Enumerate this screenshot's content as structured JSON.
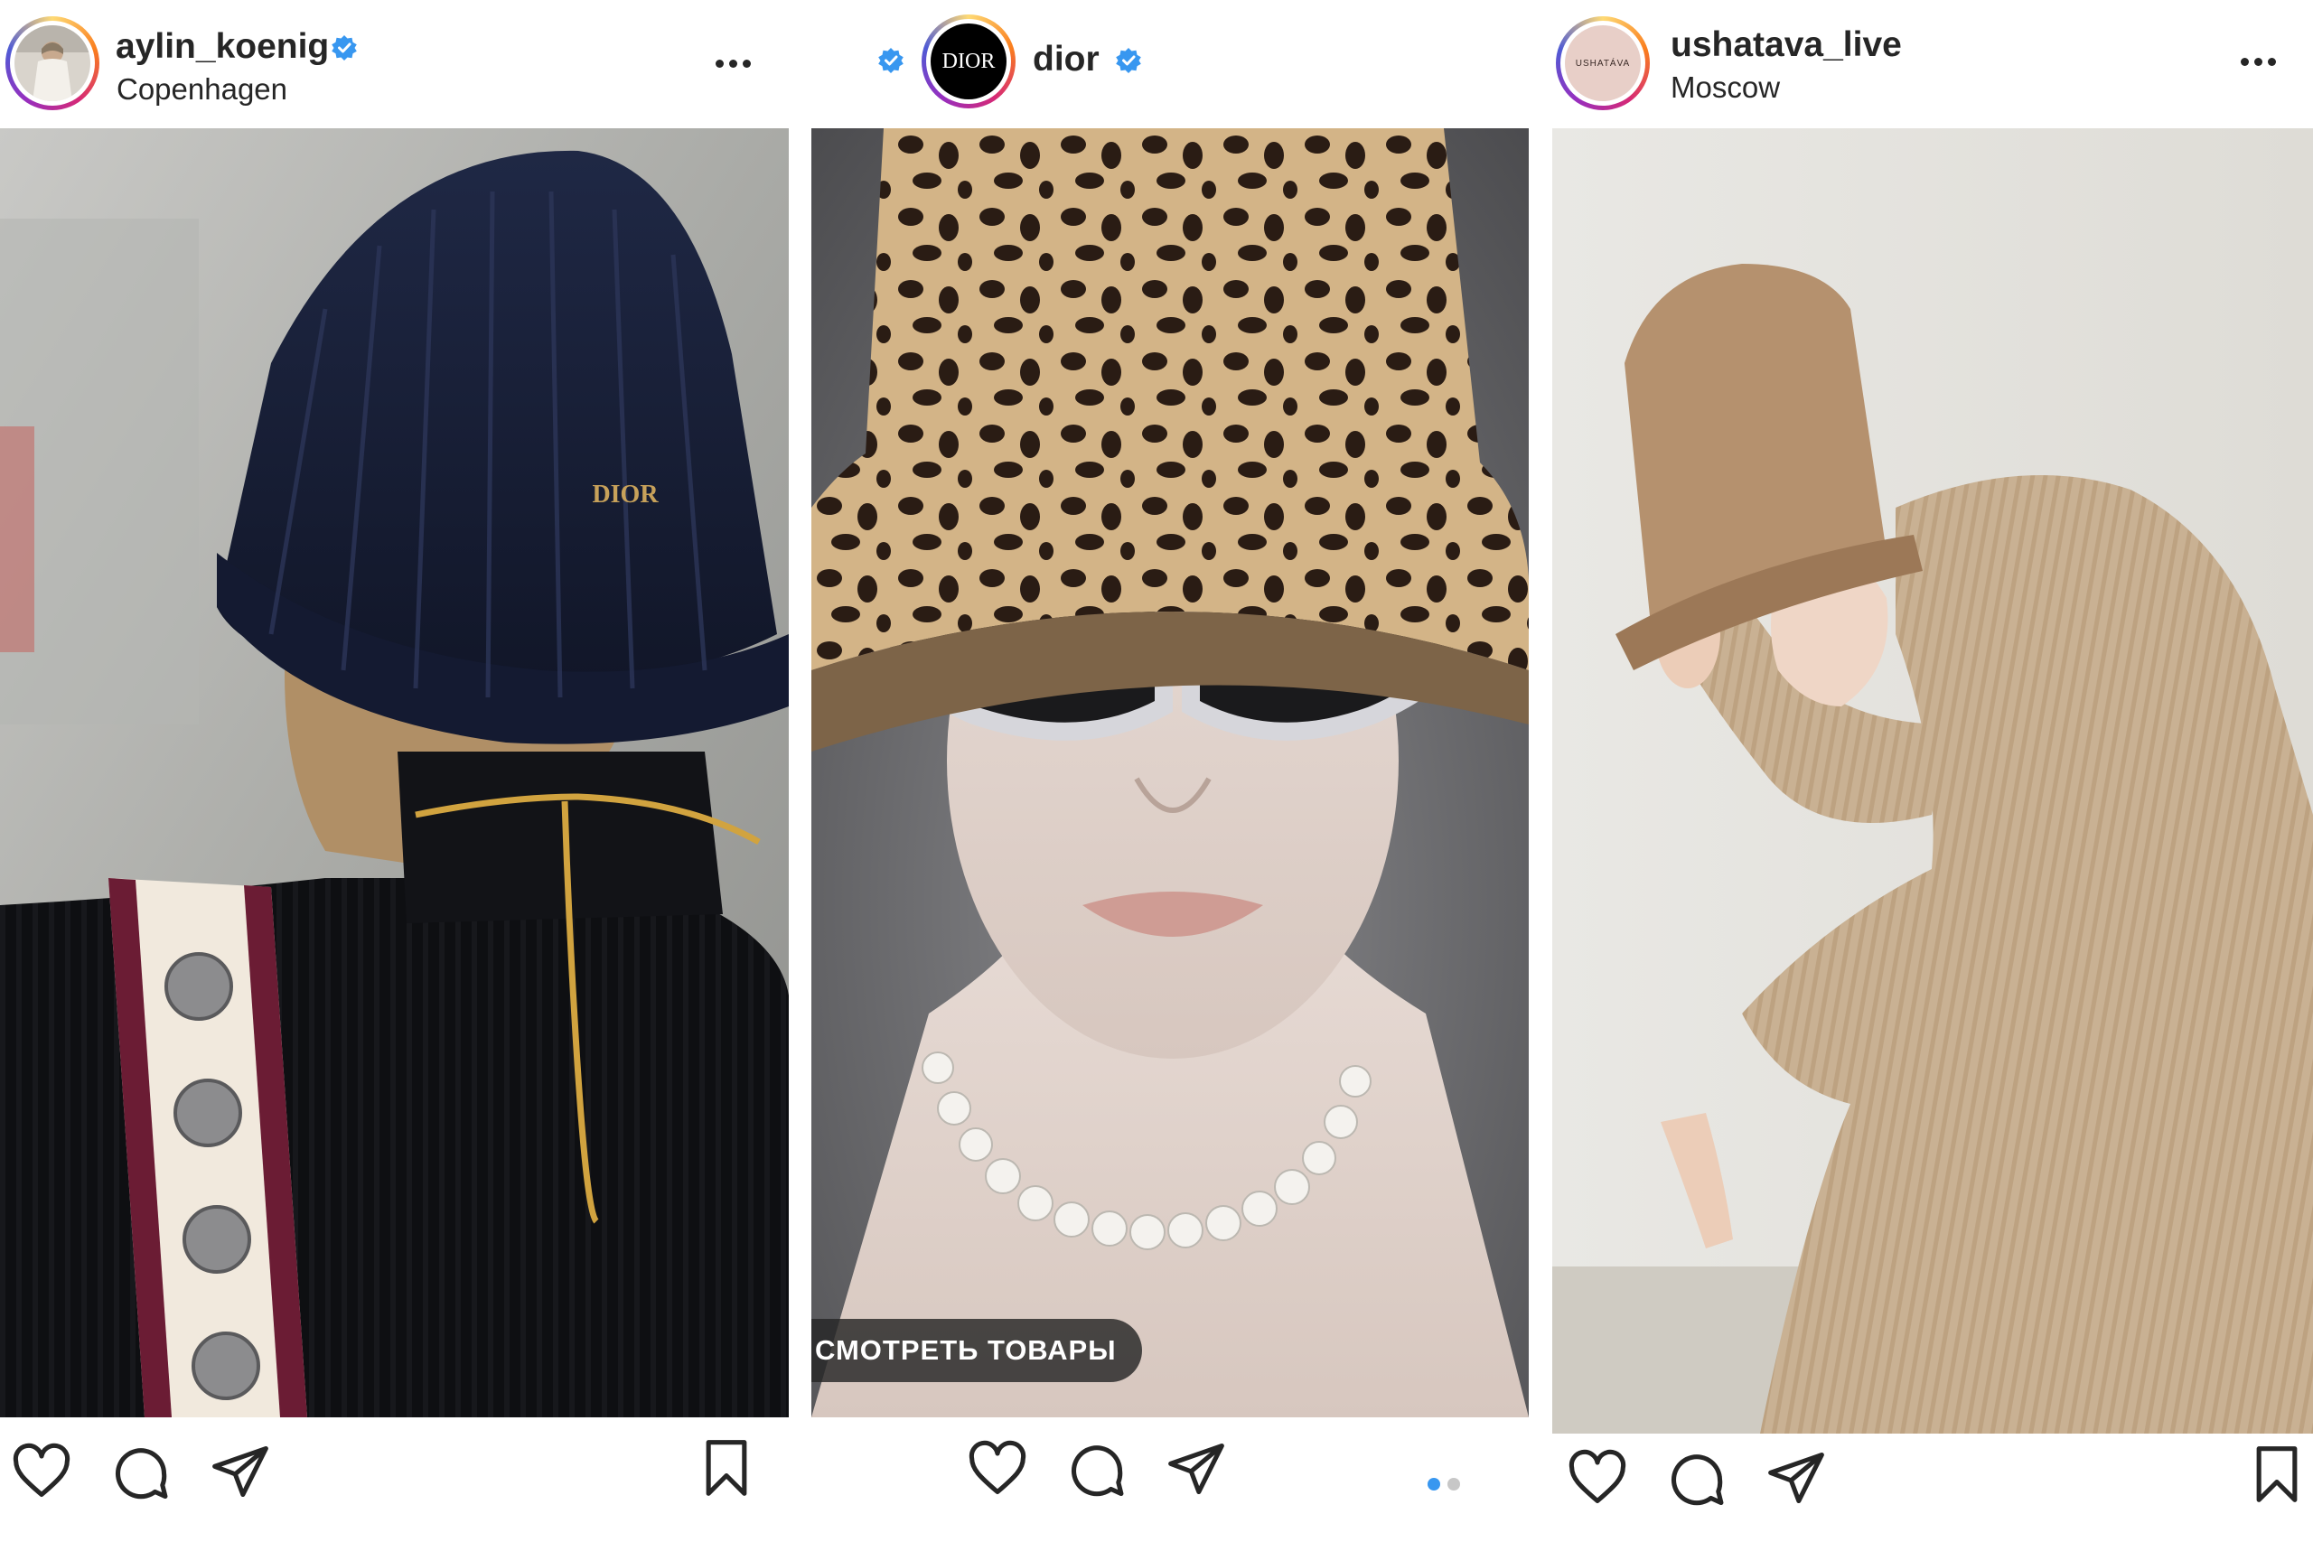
{
  "posts": [
    {
      "username": "aylin_koenig",
      "location": "Copenhagen",
      "verified": true,
      "photo_alt": "Woman from behind wearing a navy knit bucket hat with gold DIOR logo, black ribbed sweater, gold chain and embroidered bag strap",
      "hat_logo": "DIOR",
      "icons": [
        "heart-icon",
        "comment-icon",
        "share-icon",
        "bookmark-icon"
      ]
    },
    {
      "username": "dior",
      "verified": true,
      "avatar_text": "DIOR",
      "photo_alt": "Model in leopard print bucket hat, crystal cat-eye sunglasses and pearl necklace",
      "shop_label": "СМОТРЕТЬ ТОВАРЫ",
      "carousel_count": 2,
      "carousel_active": 0,
      "icons": [
        "heart-icon",
        "comment-icon",
        "share-icon"
      ]
    },
    {
      "username": "ushatava_live",
      "location": "Moscow",
      "avatar_text": "USHATÁVA",
      "photo_alt": "Woman in camel felt bucket hat and beige ribbed knit dress, seated and leaning forward",
      "icons": [
        "heart-icon",
        "comment-icon",
        "share-icon",
        "bookmark-icon"
      ]
    }
  ],
  "colors": {
    "text": "#262626",
    "verified": "#3897f0",
    "carousel_active": "#3897f0",
    "carousel_inactive": "#c7c7c7"
  }
}
